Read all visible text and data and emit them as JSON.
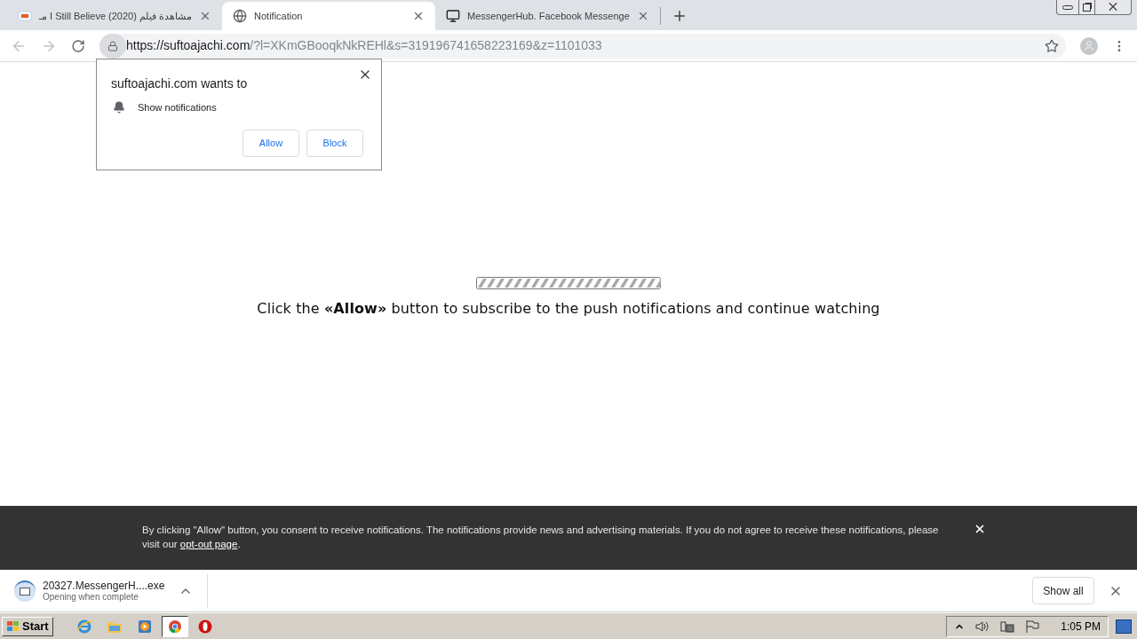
{
  "tabs": [
    {
      "title": "مشاهدة فيلم I Still Believe (2020) مـ",
      "kind": "movie",
      "selected": false
    },
    {
      "title": "Notification",
      "kind": "globe",
      "selected": true
    },
    {
      "title": "MessengerHub. Facebook Messenge",
      "kind": "monitor",
      "selected": false
    }
  ],
  "address": {
    "host": "https://suftoajachi.com",
    "path": "/?l=XKmGBooqkNkREHl&s=319196741658223169&z=1101033"
  },
  "permission_popup": {
    "title": "suftoajachi.com wants to",
    "permission": "Show notifications",
    "buttons": [
      "Allow",
      "Block"
    ]
  },
  "page": {
    "message": "Click the **«Allow»** button to subscribe to the push notifications and continue watching"
  },
  "consent_banner": {
    "text": "By clicking \"Allow\" button, you consent to receive notifications. The notifications provide news and advertising materials. If you do not agree to receive these notifications, please visit our ",
    "link": "opt-out page",
    "text_after": "."
  },
  "download_bar": {
    "file": "20327.MessengerH....exe",
    "status": "Opening when complete",
    "show_all": "Show all"
  },
  "taskbar": {
    "start": "Start",
    "clock": "1:05 PM",
    "apps": [
      {
        "kind": "ie",
        "selected": false
      },
      {
        "kind": "folder",
        "selected": false
      },
      {
        "kind": "media",
        "selected": false
      },
      {
        "kind": "chrome",
        "selected": true
      },
      {
        "kind": "opera",
        "selected": false
      }
    ]
  }
}
